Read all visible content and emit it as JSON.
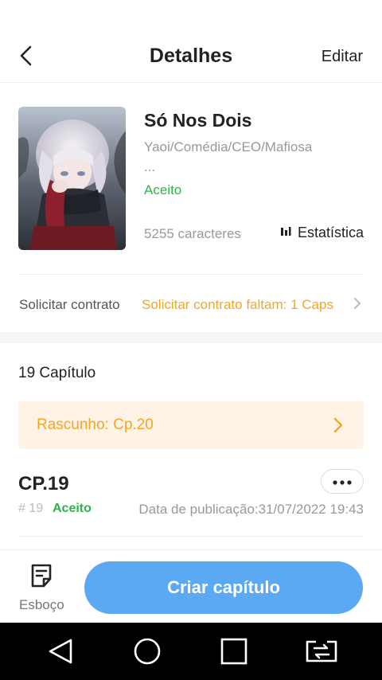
{
  "header": {
    "title": "Detalhes",
    "edit_label": "Editar"
  },
  "book": {
    "name": "Só Nos Dois",
    "genres": "Yaoi/Comédia/CEO/Mafiosa",
    "genres_more": "...",
    "status": "Aceito",
    "characters": "5255 caracteres",
    "stats_label": "Estatística"
  },
  "contract": {
    "label": "Solicitar contrato",
    "link": "Solicitar contrato faltam: 1 Caps"
  },
  "chapters": {
    "count_label": "19 Capítulo",
    "draft_label": "Rascunho: Cp.20",
    "items": [
      {
        "title": "CP.19",
        "number": "# 19",
        "status": "Aceito",
        "date": "Data de publicação:31/07/2022 19:43"
      }
    ]
  },
  "bottom": {
    "draft_label": "Esboço",
    "create_label": "Criar capítulo"
  },
  "colors": {
    "accent_blue": "#5aa9f2",
    "accepted_green": "#2fb34a",
    "warning_orange": "#f5a623",
    "draft_bg": "#fef3e6"
  },
  "icons": [
    "back-arrow-icon",
    "bar-chart-icon",
    "chevron-right-icon",
    "more-dots-icon",
    "draft-note-icon",
    "nav-back-icon",
    "nav-home-icon",
    "nav-recents-icon",
    "nav-screen-icon"
  ]
}
